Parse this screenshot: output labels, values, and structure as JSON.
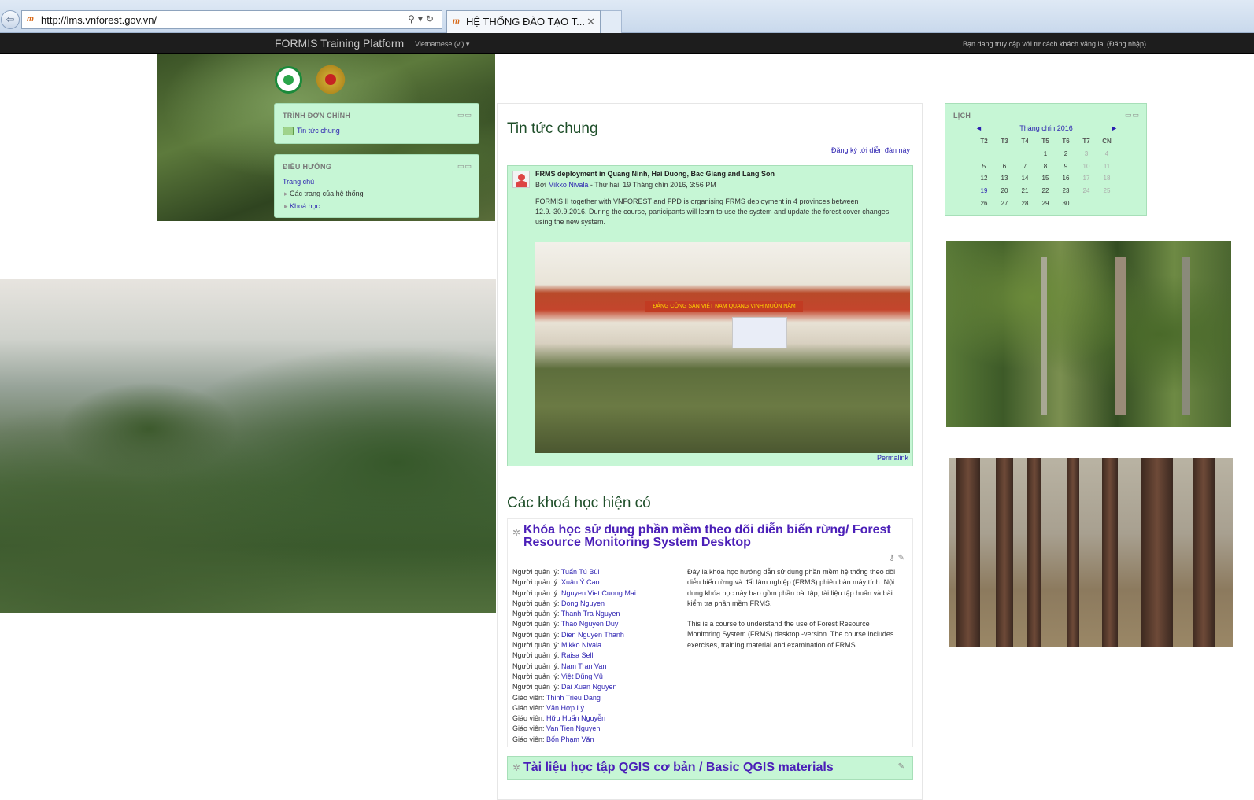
{
  "browser": {
    "url": "http://lms.vnforest.gov.vn/",
    "tab_title": "HỆ THỐNG ĐÀO TẠO T...",
    "favicon_text": "m"
  },
  "navbar": {
    "brand": "FORMIS Training Platform",
    "language": "Vietnamese (vi)",
    "login_info": "Bạn đang truy cập với tư cách khách vãng lai (Đăng nhập)"
  },
  "main_menu": {
    "title": "TRÌNH ĐƠN CHÍNH",
    "items": [
      {
        "label": "Tin tức chung"
      }
    ]
  },
  "navigation": {
    "title": "ĐIỀU HƯỚNG",
    "home": "Trang chủ",
    "items": [
      {
        "label": "Các trang của hệ thống"
      },
      {
        "label": "Khoá học"
      }
    ]
  },
  "news": {
    "heading": "Tin tức chung",
    "subscribe": "Đăng ký tới diễn đàn này",
    "post": {
      "subject": "FRMS deployment in Quang Ninh, Hai Duong, Bac Giang and Lang Son",
      "by_prefix": "Bởi ",
      "author": "Mikko Nivala",
      "date": " - Thứ hai, 19 Tháng chín 2016, 3:56 PM",
      "body": "FORMIS II together with VNFOREST and FPD is organising FRMS deployment in 4 provinces between 12.9.-30.9.2016. During the course, participants will learn to use the system and update the forest cover changes using the new system.",
      "photo_banner": "ĐẢNG CỘNG SẢN VIỆT NAM QUANG VINH MUÔN NĂM",
      "permalink": "Permalink"
    }
  },
  "courses": {
    "heading": "Các khoá học hiện có",
    "list": [
      {
        "name": "Khóa học sử dụng phần mềm theo dõi diễn biến rừng/ Forest Resource Monitoring System Desktop",
        "staff": [
          {
            "role": "Người quản lý: ",
            "name": "Tuấn Tú Bùi"
          },
          {
            "role": "Người quản lý: ",
            "name": "Xuân Ý Cao"
          },
          {
            "role": "Người quản lý: ",
            "name": "Nguyen Viet Cuong Mai"
          },
          {
            "role": "Người quản lý: ",
            "name": "Dong Nguyen"
          },
          {
            "role": "Người quản lý: ",
            "name": "Thanh Tra Nguyen"
          },
          {
            "role": "Người quản lý: ",
            "name": "Thao Nguyen Duy"
          },
          {
            "role": "Người quản lý: ",
            "name": "Dien Nguyen Thanh"
          },
          {
            "role": "Người quản lý: ",
            "name": "Mikko Nivala"
          },
          {
            "role": "Người quản lý: ",
            "name": "Raisa Sell"
          },
          {
            "role": "Người quản lý: ",
            "name": "Nam Tran Van"
          },
          {
            "role": "Người quản lý: ",
            "name": "Việt Dũng Vũ"
          },
          {
            "role": "Người quản lý: ",
            "name": "Dai Xuan Nguyen"
          },
          {
            "role": "Giáo viên: ",
            "name": "Thinh Trieu Dang"
          },
          {
            "role": "Giáo viên: ",
            "name": "Văn Hợp Lý"
          },
          {
            "role": "Giáo viên: ",
            "name": "Hữu Huấn Nguyễn"
          },
          {
            "role": "Giáo viên: ",
            "name": "Van Tien Nguyen"
          },
          {
            "role": "Giáo viên: ",
            "name": "Bốn Phạm Văn"
          }
        ],
        "summary_vi": "Đây là khóa học hướng dẫn sử dụng phần mềm hệ thống theo dõi diễn biến rừng và đất lâm nghiệp (FRMS) phiên bản máy tính. Nội dung khóa học này bao gồm phần bài tập, tài liệu tập huấn và bài kiểm tra phần mềm FRMS.",
        "summary_en": "This is a course to understand the use of Forest Resource Monitoring System (FRMS) desktop -version. The course includes exercises, training material and examination of FRMS."
      },
      {
        "name": "Tài liệu học tập QGIS cơ bản / Basic QGIS materials"
      }
    ]
  },
  "calendar": {
    "title": "LỊCH",
    "month": "Tháng chín 2016",
    "prev": "◄",
    "next": "►",
    "weekdays": [
      "T2",
      "T3",
      "T4",
      "T5",
      "T6",
      "T7",
      "CN"
    ],
    "weeks": [
      [
        "",
        "",
        "",
        "1",
        "2",
        "3",
        "4"
      ],
      [
        "5",
        "6",
        "7",
        "8",
        "9",
        "10",
        "11"
      ],
      [
        "12",
        "13",
        "14",
        "15",
        "16",
        "17",
        "18"
      ],
      [
        "19",
        "20",
        "21",
        "22",
        "23",
        "24",
        "25"
      ],
      [
        "26",
        "27",
        "28",
        "29",
        "30",
        "",
        ""
      ]
    ],
    "today": "19"
  },
  "icons": {
    "back": "back-arrow-icon",
    "search": "search-icon",
    "refresh": "refresh-icon",
    "close": "close-icon",
    "forum": "forum-icon",
    "expand": "triangle-right-icon",
    "course": "course-icon",
    "edit": "edit-icon"
  },
  "colors": {
    "block_bg": "#c6f6d5",
    "link": "#2a1fb0",
    "heading": "#1f4f2a",
    "course_title": "#4b1fb8",
    "navbar": "#1d1d1d"
  }
}
